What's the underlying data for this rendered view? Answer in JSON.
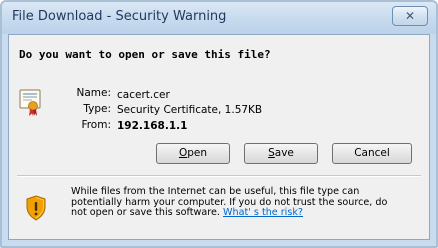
{
  "window": {
    "title": "File Download - Security Warning",
    "close_glyph": "✕"
  },
  "dialog": {
    "question": "Do you want to open or save this file?",
    "file_icon": "certificate-icon",
    "fields": {
      "name_label": "Name:",
      "name_value": "cacert.cer",
      "type_label": "Type:",
      "type_value": "Security Certificate, 1.57KB",
      "from_label": "From:",
      "from_value": "192.168.1.1"
    },
    "buttons": {
      "open_label": "Open",
      "open_mnemonic": "O",
      "save_label": "Save",
      "save_mnemonic": "S",
      "cancel_label": "Cancel"
    },
    "warning": {
      "icon": "shield-warning-icon",
      "line1": "While files from the Internet can be useful, this file type can",
      "line2": "potentially harm your computer. If you do not trust the source, do",
      "line3_text": "not open or save this software.",
      "link_text": "What' s the risk?"
    }
  },
  "colors": {
    "titlebar": "#c7daee",
    "client_bg": "#f0f0f0",
    "link": "#0066cc",
    "shield_orange": "#f0a000"
  }
}
